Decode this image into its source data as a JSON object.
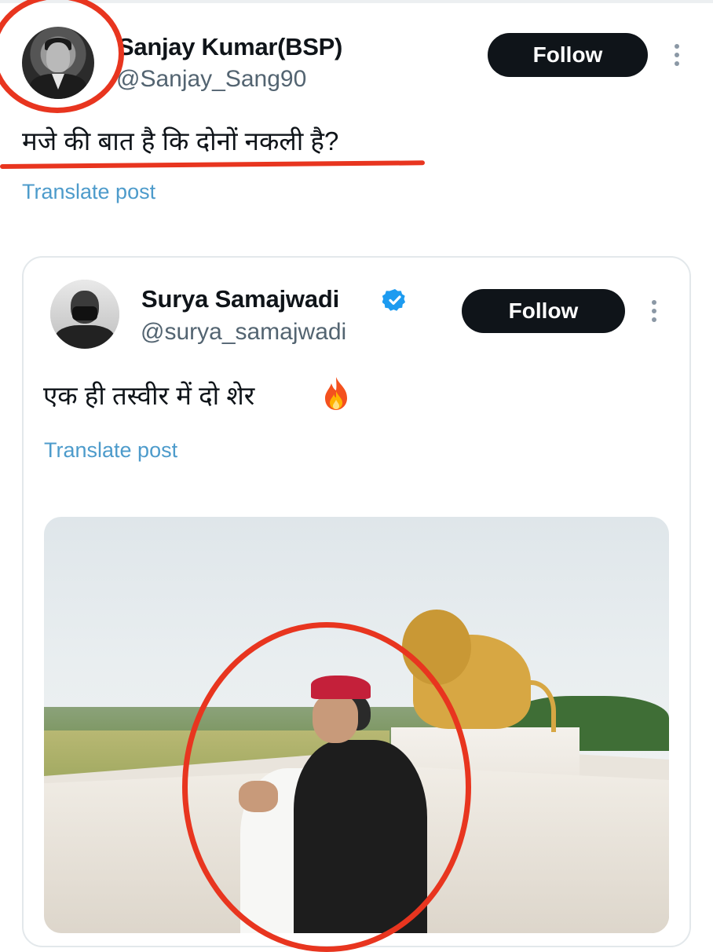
{
  "post": {
    "author_name": "Sanjay Kumar(BSP)",
    "author_handle": "@Sanjay_Sang90",
    "follow_label": "Follow",
    "text": "मजे की बात है कि दोनों नकली है?",
    "translate_label": "Translate post"
  },
  "quoted_post": {
    "author_name": "Surya Samajwadi",
    "author_handle": "@surya_samajwadi",
    "verified": true,
    "follow_label": "Follow",
    "text": "एक ही तस्वीर में दो शेर",
    "emoji_icon": "fire-icon",
    "translate_label": "Translate post"
  },
  "colors": {
    "follow_button_bg": "#0f1419",
    "link_blue": "#4d9bcb",
    "verified_blue": "#1d9bf0",
    "annotation_red": "#e8351f",
    "secondary_text": "#536471"
  }
}
